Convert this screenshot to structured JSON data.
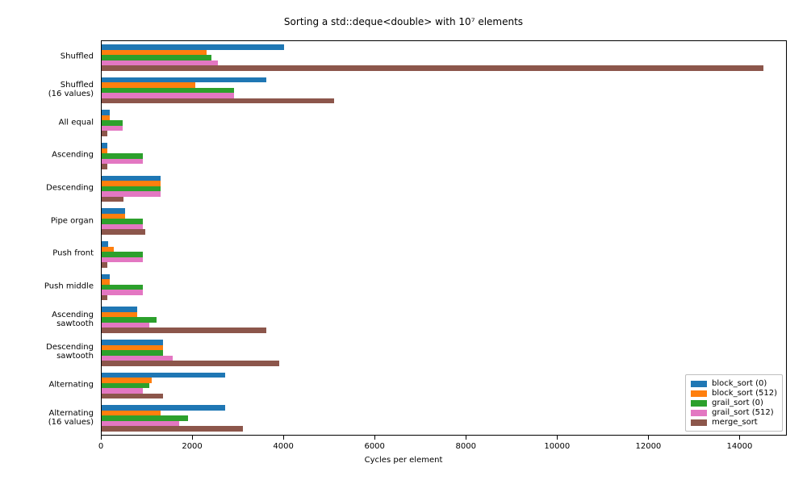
{
  "chart_data": {
    "type": "bar",
    "title": "Sorting a std::deque<double> with 10⁷ elements",
    "xlabel": "Cycles per element",
    "ylabel": "",
    "xlim": [
      0,
      15000
    ],
    "xticks": [
      0,
      2000,
      4000,
      6000,
      8000,
      10000,
      12000,
      14000
    ],
    "categories": [
      "Shuffled",
      "Shuffled\n(16 values)",
      "All equal",
      "Ascending",
      "Descending",
      "Pipe organ",
      "Push front",
      "Push middle",
      "Ascending\nsawtooth",
      "Descending\nsawtooth",
      "Alternating",
      "Alternating\n(16 values)"
    ],
    "series": [
      {
        "name": "block_sort (0)",
        "color": "#1f77b4",
        "values": [
          4000,
          3600,
          170,
          120,
          1300,
          520,
          150,
          180,
          780,
          1350,
          2700,
          2700
        ]
      },
      {
        "name": "block_sort (512)",
        "color": "#ff7f0e",
        "values": [
          2300,
          2050,
          170,
          120,
          1300,
          520,
          270,
          180,
          780,
          1350,
          1100,
          1300
        ]
      },
      {
        "name": "grail_sort (0)",
        "color": "#2ca02c",
        "values": [
          2400,
          2900,
          460,
          900,
          1300,
          900,
          900,
          900,
          1200,
          1350,
          1050,
          1900
        ]
      },
      {
        "name": "grail_sort (512)",
        "color": "#e377c2",
        "values": [
          2550,
          2900,
          460,
          900,
          1300,
          900,
          900,
          900,
          1050,
          1550,
          900,
          1700
        ]
      },
      {
        "name": "merge_sort",
        "color": "#8c564b",
        "values": [
          14500,
          5100,
          120,
          120,
          470,
          950,
          120,
          120,
          3600,
          3900,
          1350,
          3100
        ]
      }
    ],
    "legend_position": "lower right"
  }
}
